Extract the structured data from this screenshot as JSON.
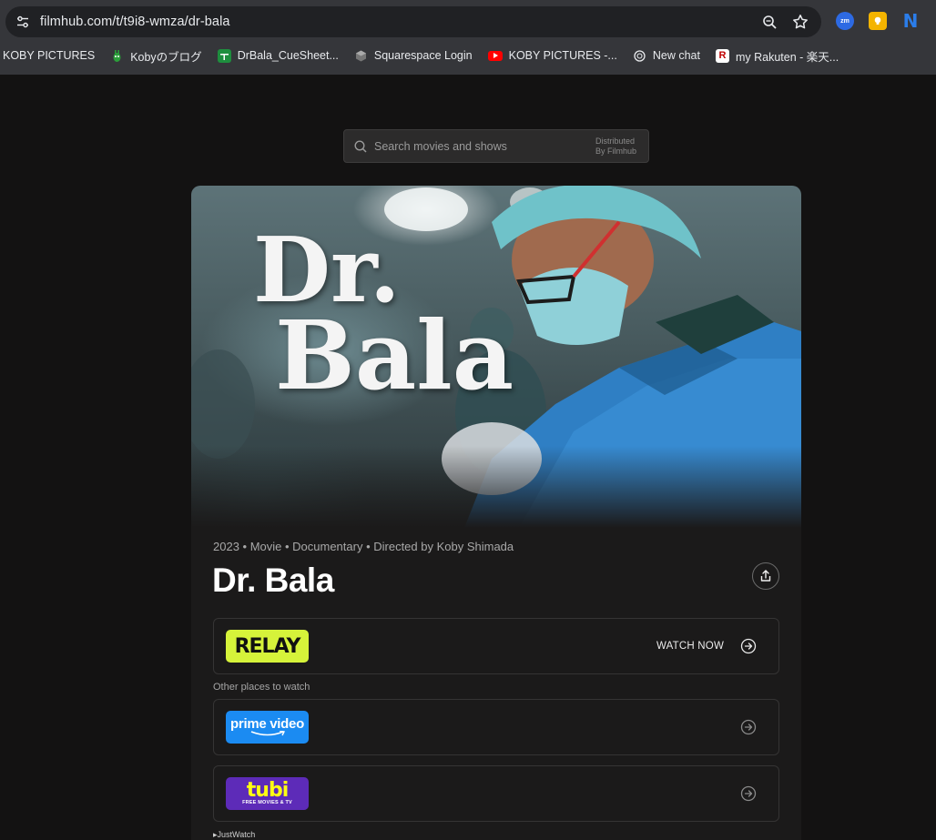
{
  "browser": {
    "url": "filmhub.com/t/t9i8-wmza/dr-bala",
    "bookmarks": [
      {
        "label": "KOBY PICTURES"
      },
      {
        "label": "Kobyのブログ"
      },
      {
        "label": "DrBala_CueSheet..."
      },
      {
        "label": "Squarespace Login"
      },
      {
        "label": "KOBY PICTURES -..."
      },
      {
        "label": "New chat"
      },
      {
        "label": "my Rakuten - 楽天..."
      }
    ],
    "extensions": {
      "zoom": "zm",
      "notion": "N"
    }
  },
  "search": {
    "placeholder": "Search movies and shows",
    "distributed_line1": "Distributed",
    "distributed_line2": "By Filmhub"
  },
  "poster": {
    "title_line1": "Dr.",
    "title_line2": "Bala"
  },
  "movie": {
    "meta": "2023 • Movie • Documentary • Directed by Koby Shimada",
    "title": "Dr. Bala"
  },
  "providers": {
    "primary": {
      "logo_text": "RELAY",
      "action": "WATCH NOW"
    },
    "other_label": "Other places to watch",
    "prime": {
      "logo_text": "prime video"
    },
    "tubi": {
      "logo_text": "tubi",
      "logo_sub": "FREE MOVIES & TV"
    }
  },
  "footer": {
    "justwatch": "JustWatch"
  },
  "colors": {
    "page_bg": "#131212",
    "card_bg": "#1b1a1a",
    "relay": "#d6f33a",
    "prime": "#1b8bf2",
    "tubi": "#5d2bb8"
  }
}
